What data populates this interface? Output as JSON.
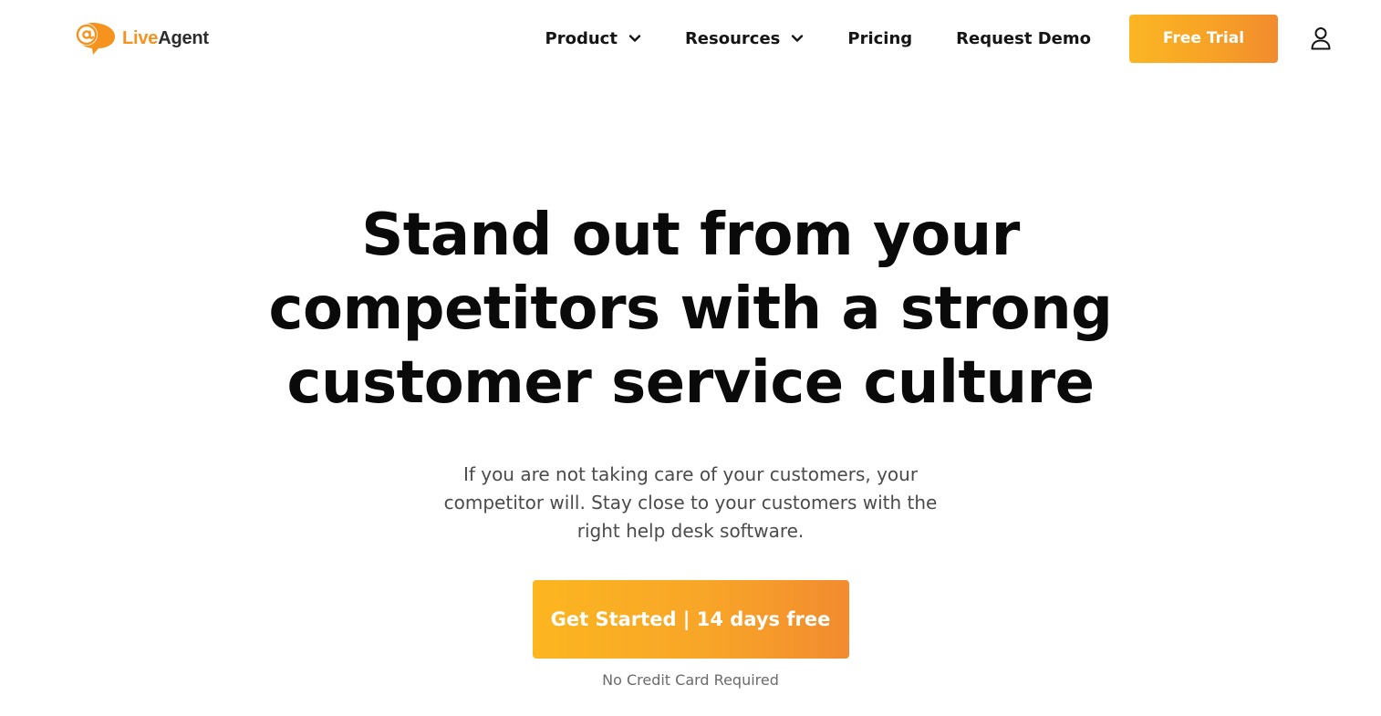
{
  "header": {
    "logo": {
      "word1": "Live",
      "word2": "Agent",
      "icon": "at-speech-bubble-icon"
    },
    "nav": [
      {
        "label": "Product",
        "has_dropdown": true
      },
      {
        "label": "Resources",
        "has_dropdown": true
      },
      {
        "label": "Pricing",
        "has_dropdown": false
      },
      {
        "label": "Request Demo",
        "has_dropdown": false
      }
    ],
    "free_trial_label": "Free Trial",
    "user_icon": "user-icon"
  },
  "hero": {
    "title_lines": [
      "Stand out from your",
      "competitors with a strong",
      "customer service culture"
    ],
    "subtitle": "If you are not taking care of your customers, your competitor will. Stay close to your customers with the right help desk software.",
    "cta_label": "Get Started | 14 days free",
    "cta_note": "No Credit Card Required"
  },
  "colors": {
    "accent_start": "#fbb623",
    "accent_end": "#f28b2e",
    "logo_orange": "#f6931e",
    "text_dark": "#0a0a0a",
    "text_muted": "#4b4b4b"
  }
}
